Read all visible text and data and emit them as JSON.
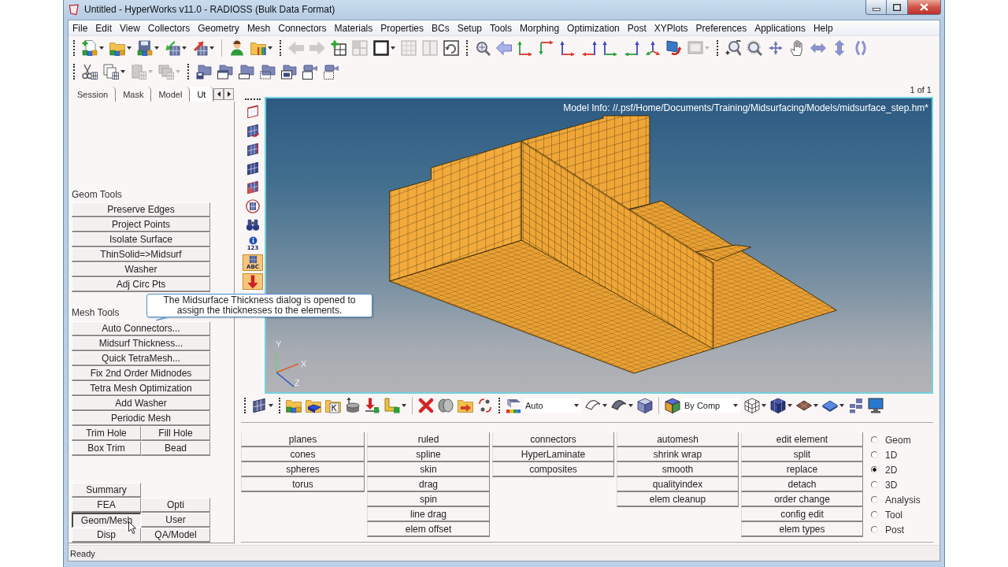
{
  "window": {
    "title": "Untitled - HyperWorks v11.0 - RADIOSS (Bulk Data Format)"
  },
  "menu_bar": [
    "File",
    "Edit",
    "View",
    "Collectors",
    "Geometry",
    "Mesh",
    "Connectors",
    "Materials",
    "Properties",
    "BCs",
    "Setup",
    "Tools",
    "Morphing",
    "Optimization",
    "Post",
    "XYPlots",
    "Preferences",
    "Applications",
    "Help"
  ],
  "toolbar_1": [
    {
      "disabled": false
    },
    {
      "disabled": false
    },
    {
      "disabled": false
    },
    {
      "disabled": false
    },
    {
      "disabled": false
    },
    {
      "disabled": false
    },
    {
      "disabled": false
    },
    {
      "disabled": true
    },
    {
      "disabled": true
    },
    {
      "disabled": false
    },
    {
      "disabled": true
    },
    {
      "disabled": false
    },
    {
      "disabled": true
    },
    {
      "disabled": true
    },
    {
      "disabled": false
    },
    {
      "disabled": false
    },
    {
      "disabled": false
    },
    {
      "disabled": false
    },
    {
      "disabled": false
    },
    {
      "disabled": false
    },
    {
      "disabled": false
    },
    {
      "disabled": false
    },
    {
      "disabled": false
    },
    {
      "disabled": false
    },
    {
      "disabled": false
    },
    {
      "disabled": true
    },
    {
      "disabled": false
    },
    {
      "disabled": false
    },
    {
      "disabled": false
    },
    {
      "disabled": false
    },
    {
      "disabled": false
    },
    {
      "disabled": false
    },
    {
      "disabled": false
    }
  ],
  "toolbar_2": [
    {
      "disabled": false
    },
    {
      "disabled": false
    },
    {
      "disabled": true
    },
    {
      "disabled": true
    },
    {
      "disabled": false
    },
    {
      "disabled": false
    },
    {
      "disabled": false
    },
    {
      "disabled": false
    },
    {
      "disabled": false
    },
    {
      "disabled": false
    },
    {
      "disabled": false
    }
  ],
  "left_panel": {
    "tabs": [
      {
        "label": "Session",
        "selected": false
      },
      {
        "label": "Mask",
        "selected": false
      },
      {
        "label": "Model",
        "selected": false
      },
      {
        "label": "Ut",
        "selected": true
      }
    ],
    "sections": [
      {
        "title": "Geom Tools",
        "rows": [
          [
            "Preserve Edges"
          ],
          [
            "Project Points"
          ],
          [
            "Isolate Surface"
          ],
          [
            "ThinSolid=>Midsurf"
          ],
          [
            "Washer"
          ],
          [
            "Adj Circ Pts"
          ]
        ]
      },
      {
        "title": "Mesh Tools",
        "rows": [
          [
            "Auto Connectors..."
          ],
          [
            "Midsurf Thickness..."
          ],
          [
            "Quick TetraMesh..."
          ],
          [
            "Fix 2nd Order Midnodes"
          ],
          [
            "Tetra Mesh Optimization"
          ],
          [
            "Add Washer"
          ],
          [
            "Periodic Mesh"
          ],
          [
            "Trim Hole",
            "Fill Hole"
          ],
          [
            "Box Trim",
            "Bead"
          ]
        ]
      }
    ],
    "pages": [
      [
        {
          "label": "Summary",
          "selected": false
        }
      ],
      [
        {
          "label": "FEA",
          "selected": false
        },
        {
          "label": "Opti",
          "selected": false
        }
      ],
      [
        {
          "label": "Geom/Mesh",
          "selected": true
        },
        {
          "label": "User",
          "selected": false
        }
      ],
      [
        {
          "label": "Disp",
          "selected": false
        },
        {
          "label": "QA/Model",
          "selected": false
        }
      ]
    ]
  },
  "page_counter": "1 of 1",
  "side_toolbar": [
    {
      "selected": false
    },
    {
      "selected": false
    },
    {
      "selected": false
    },
    {
      "selected": false
    },
    {
      "selected": false
    },
    {
      "selected": false
    },
    {
      "selected": false
    },
    {
      "label": "123",
      "selected": false
    },
    {
      "label": "ABC",
      "selected": true
    },
    {
      "selected": true
    }
  ],
  "viewport": {
    "model_info": "Model Info: //.psf/Home/Documents/Training/Midsurfacing/Models/midsurface_step.hm*",
    "axis_labels": [
      "Y",
      "X",
      "Z"
    ]
  },
  "tooltip": "The Midsurface Thickness dialog is opened to assign the thicknesses to the elements.",
  "bottom_toolbar": {
    "dropdowns": [
      {
        "value": "Auto"
      },
      {
        "value": "By Comp"
      }
    ]
  },
  "panel": {
    "columns": [
      [
        "planes",
        "cones",
        "spheres",
        "torus"
      ],
      [
        "ruled",
        "spline",
        "skin",
        "drag",
        "spin",
        "line drag",
        "elem offset"
      ],
      [
        "connectors",
        "HyperLaminate",
        "composites"
      ],
      [
        "automesh",
        "shrink wrap",
        "smooth",
        "qualityindex",
        "elem cleanup"
      ],
      [
        "edit element",
        "split",
        "replace",
        "detach",
        "order change",
        "config edit",
        "elem types"
      ]
    ],
    "radios": [
      {
        "label": "Geom",
        "selected": false
      },
      {
        "label": "1D",
        "selected": false
      },
      {
        "label": "2D",
        "selected": true
      },
      {
        "label": "3D",
        "selected": false
      },
      {
        "label": "Analysis",
        "selected": false
      },
      {
        "label": "Tool",
        "selected": false
      },
      {
        "label": "Post",
        "selected": false
      }
    ]
  },
  "status_bar": "Ready"
}
